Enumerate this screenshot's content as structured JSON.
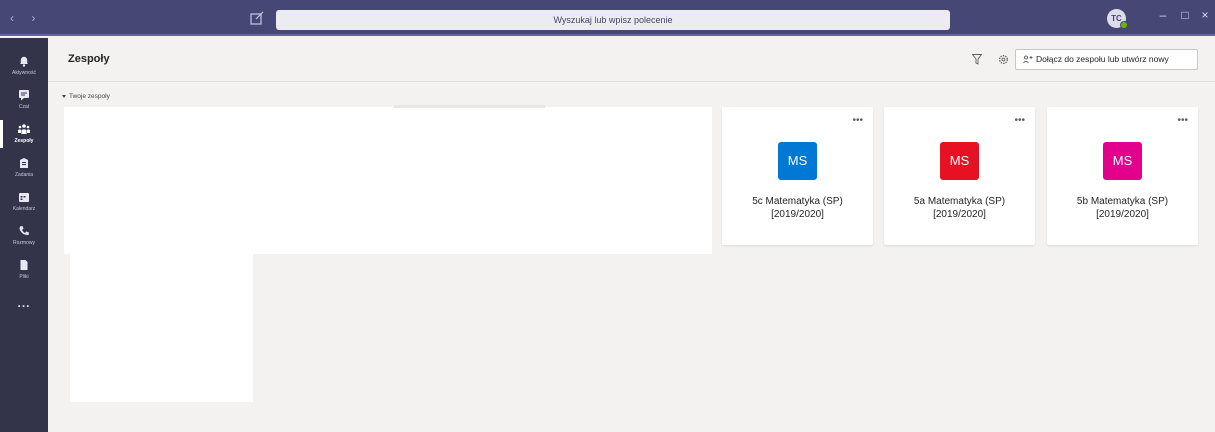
{
  "titlebar": {
    "search_placeholder": "Wyszukaj lub wpisz polecenie",
    "avatar_initials": "TC",
    "nav_arrows": "‹ ›",
    "minimize": "–",
    "maximize": "□",
    "close": "×"
  },
  "appbar": {
    "items": [
      {
        "label": "Aktywność",
        "icon": "bell-icon"
      },
      {
        "label": "Czat",
        "icon": "chat-icon"
      },
      {
        "label": "Zespoły",
        "icon": "teams-icon"
      },
      {
        "label": "Zadania",
        "icon": "assignments-icon"
      },
      {
        "label": "Kalendarz",
        "icon": "calendar-icon"
      },
      {
        "label": "Rozmowy",
        "icon": "phone-icon"
      },
      {
        "label": "Pliki",
        "icon": "files-icon"
      }
    ],
    "more": "..."
  },
  "header": {
    "title": "Zespoły",
    "join_label": "Dołącz do zespołu lub utwórz nowy"
  },
  "section": {
    "label": "Twoje zespoły"
  },
  "teams": [
    {
      "initials": "MS",
      "name_line1": "5c Matematyka (SP)",
      "name_line2": "[2019/2020]",
      "color": "#0078d4"
    },
    {
      "initials": "MS",
      "name_line1": "5a Matematyka (SP)",
      "name_line2": "[2019/2020]",
      "color": "#e81123"
    },
    {
      "initials": "MS",
      "name_line1": "5b Matematyka (SP)",
      "name_line2": "[2019/2020]",
      "color": "#e3008c"
    }
  ],
  "colors": {
    "titlebar": "#464775",
    "appbar": "#33344a",
    "background": "#f3f2f1"
  }
}
